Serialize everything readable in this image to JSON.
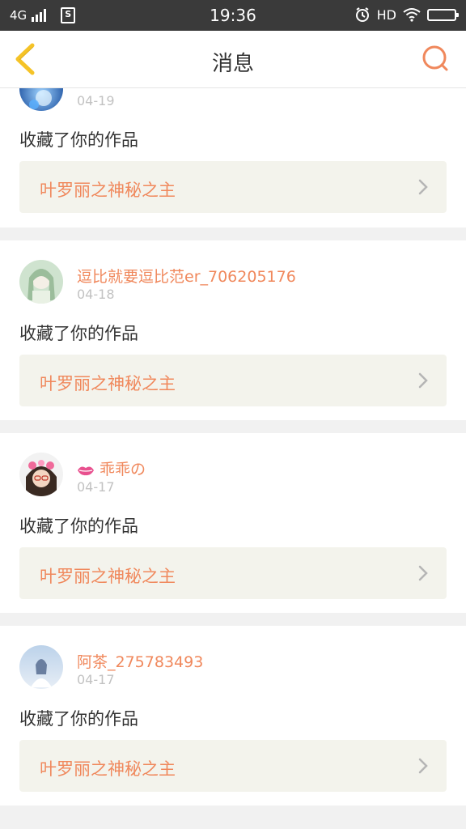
{
  "status_bar": {
    "network": "4G",
    "s_label": "S",
    "time": "19:36",
    "hd": "HD"
  },
  "header": {
    "title": "消息"
  },
  "messages": [
    {
      "username": "",
      "date": "04-19",
      "action": "收藏了你的作品",
      "work_title": "叶罗丽之神秘之主"
    },
    {
      "username": "逗比就要逗比范er_706205176",
      "date": "04-18",
      "action": "收藏了你的作品",
      "work_title": "叶罗丽之神秘之主"
    },
    {
      "username": "乖乖の",
      "date": "04-17",
      "action": "收藏了你的作品",
      "work_title": "叶罗丽之神秘之主"
    },
    {
      "username": "阿茶_275783493",
      "date": "04-17",
      "action": "收藏了你的作品",
      "work_title": "叶罗丽之神秘之主"
    }
  ],
  "colors": {
    "accent": "#f0885c",
    "back_icon": "#f5c327",
    "date": "#c2c2c2",
    "work_bg": "#f3f3ec"
  },
  "icons": {
    "back": "chevron-left-icon",
    "search": "search-icon",
    "arrow": "chevron-right-icon",
    "badge": "lips-icon"
  }
}
